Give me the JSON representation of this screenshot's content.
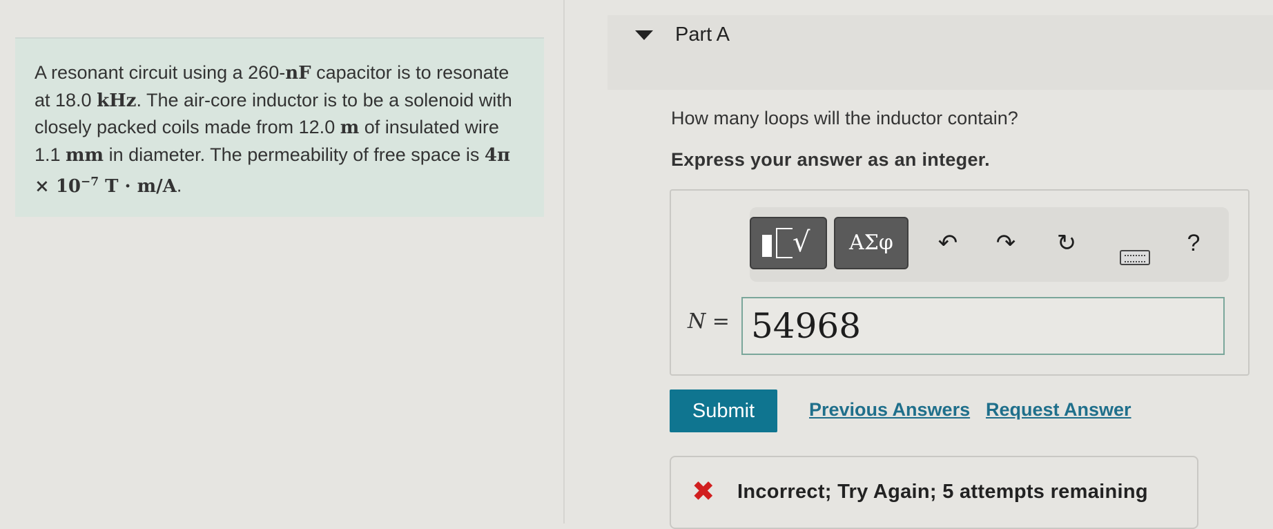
{
  "problem": {
    "seg1": "A resonant circuit using a 260-",
    "cap_unit": "nF",
    "seg2": " capacitor is to resonate at 18.0 ",
    "freq_unit": "kHz",
    "seg3": ". The air-core inductor is to be a solenoid with closely packed coils made from 12.0 ",
    "len_unit": "m",
    "seg4": " of insulated wire 1.1 ",
    "dia_unit": "mm",
    "seg5": " in diameter. The permeability of free space is ",
    "mu0": "4π × 10",
    "mu0_exp": "−7",
    "mu0_unit": " T · m/A",
    "seg6": "."
  },
  "part": {
    "title": "Part A"
  },
  "question": "How many loops will the inductor contain?",
  "instruction": "Express your answer as an integer.",
  "toolbar": {
    "symbols_label": "ΑΣφ",
    "undo_glyph": "↶",
    "redo_glyph": "↷",
    "reset_glyph": "↻",
    "help_glyph": "?",
    "icons": [
      "templates-icon",
      "greek-symbols-icon",
      "undo-icon",
      "redo-icon",
      "reset-icon",
      "keyboard-icon",
      "help-icon"
    ]
  },
  "answer": {
    "var": "N",
    "eq": " =",
    "value": "54968"
  },
  "actions": {
    "submit": "Submit",
    "previous": "Previous Answers",
    "request": "Request Answer"
  },
  "feedback": {
    "mark": "✖",
    "text": "Incorrect; Try Again; 5 attempts remaining",
    "color": "#d11f1f"
  },
  "colors": {
    "accent": "#0f7590",
    "link": "#1f6f8b",
    "problem_bg": "#d9e5de"
  }
}
